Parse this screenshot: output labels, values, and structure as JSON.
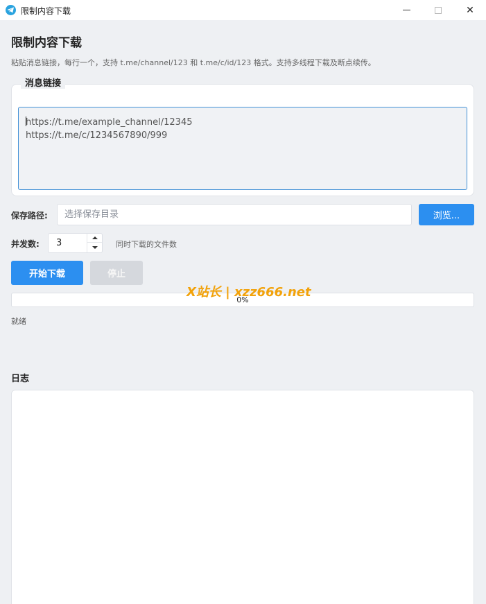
{
  "window": {
    "title": "限制内容下载",
    "minimize_icon": "minimize-icon",
    "maximize_icon": "maximize-icon",
    "close_icon": "close-icon",
    "close_glyph": "✕"
  },
  "header": {
    "title": "限制内容下载",
    "description": "粘贴消息链接，每行一个，支持 t.me/channel/123 和 t.me/c/id/123 格式。支持多线程下载及断点续传。"
  },
  "links": {
    "group_title": "消息链接",
    "value": "https://t.me/example_channel/12345\nhttps://t.me/c/1234567890/999"
  },
  "save_path": {
    "label": "保存路径:",
    "placeholder": "选择保存目录",
    "browse_label": "浏览..."
  },
  "concurrency": {
    "label": "并发数:",
    "value": "3",
    "hint": "同时下载的文件数"
  },
  "actions": {
    "start_label": "开始下载",
    "stop_label": "停止"
  },
  "watermark": "X站长 | xzz666.net",
  "progress": {
    "percent": 0,
    "text": "0%"
  },
  "status": "就绪",
  "log": {
    "label": "日志"
  },
  "colors": {
    "accent": "#2c8ff0",
    "disabled": "#d5d8dd",
    "watermark": "#f2a20a",
    "background": "#eef0f3"
  }
}
